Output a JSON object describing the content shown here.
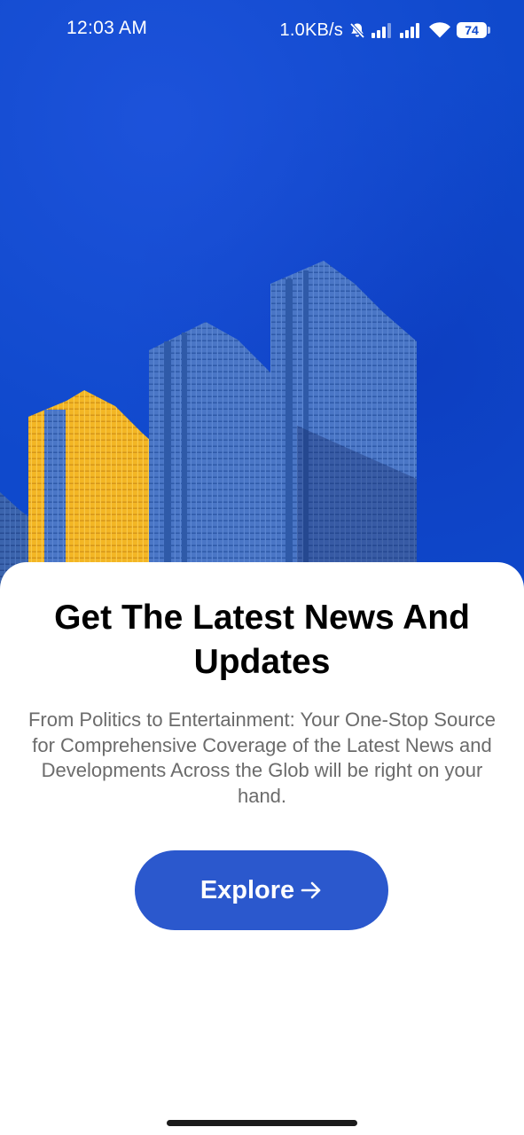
{
  "status_bar": {
    "time": "12:03 AM",
    "net_speed": "1.0KB/s",
    "battery_level": "74",
    "icons": [
      "mute-icon",
      "signal-icon",
      "signal-icon",
      "wifi-icon",
      "battery-icon"
    ]
  },
  "hero": {
    "image": "city-skyscrapers-illustration",
    "colors": {
      "sky": "#0f49cc",
      "building_blue": "#4d78c9",
      "building_yellow": "#f3b624"
    }
  },
  "onboarding": {
    "title": "Get The Latest News And Updates",
    "description": "From Politics to Entertainment: Your One-Stop Source for Comprehensive Coverage of the Latest News and Developments Across the Glob will be right on your hand.",
    "cta_label": "Explore",
    "cta_icon": "arrow-right-icon",
    "accent_color": "#2b58cd"
  }
}
